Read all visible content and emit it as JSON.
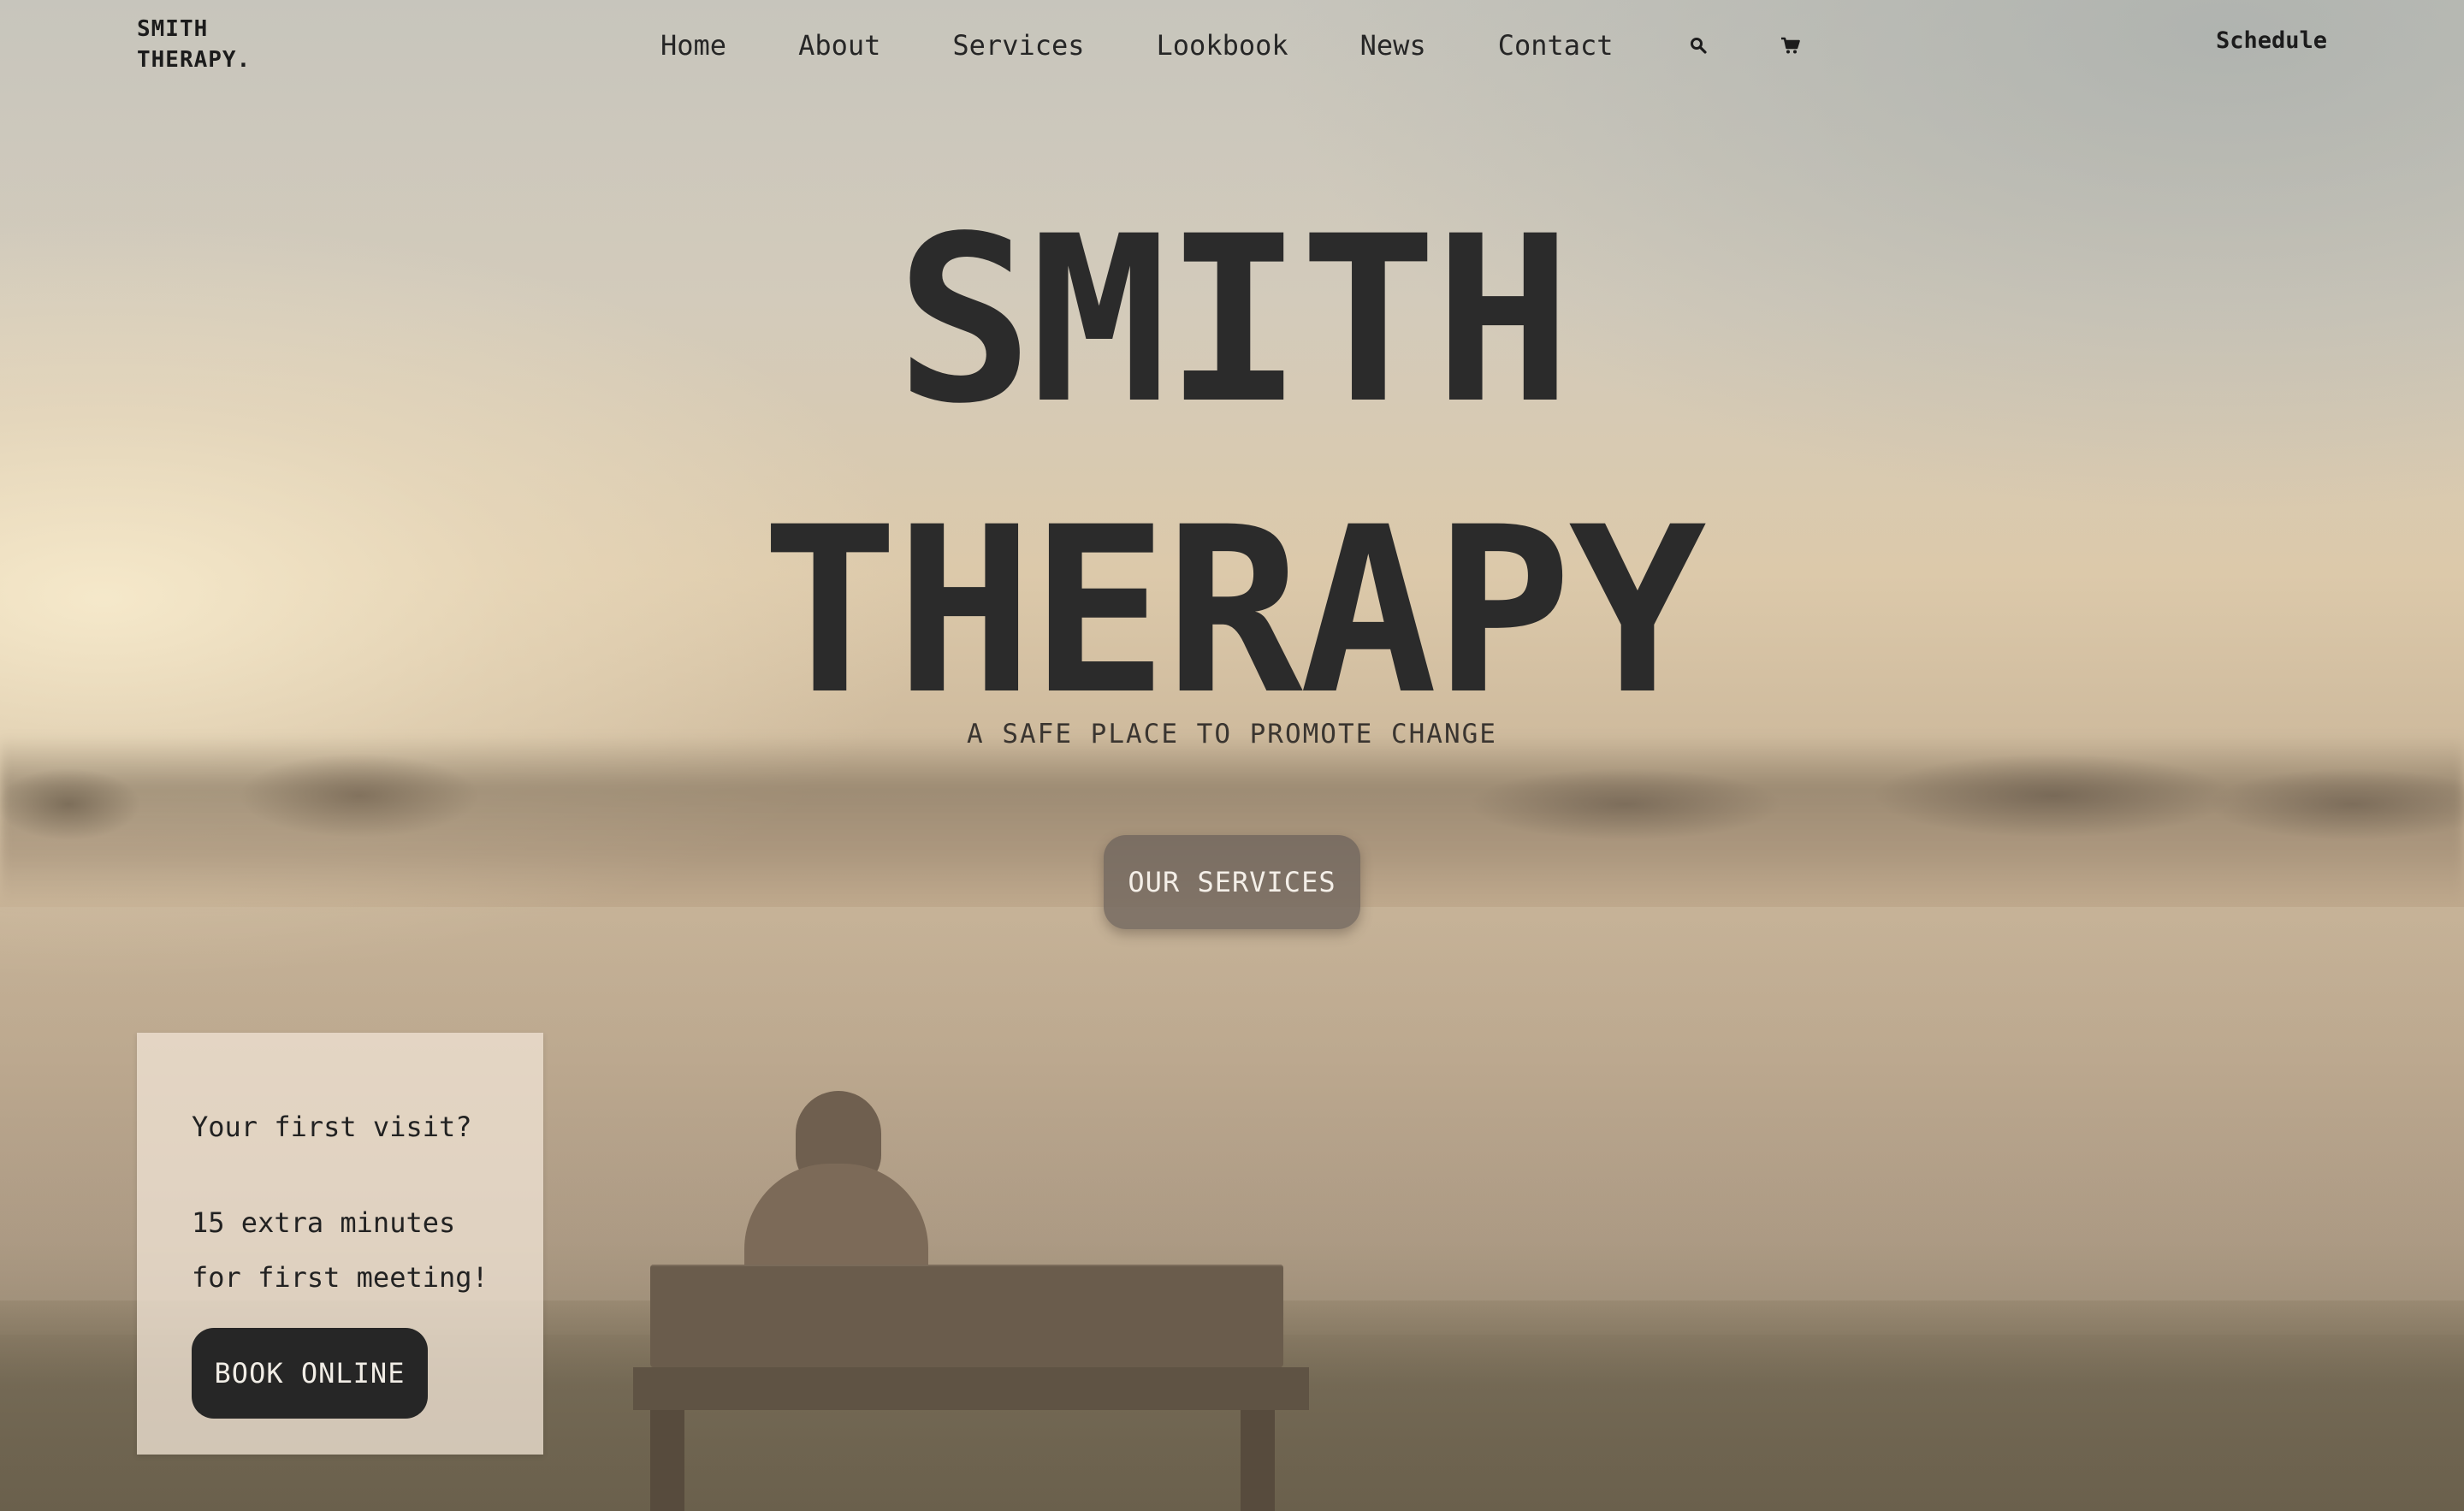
{
  "brand": {
    "line1": "SMITH",
    "line2": "THERAPY."
  },
  "nav": {
    "items": [
      {
        "label": "Home"
      },
      {
        "label": "About"
      },
      {
        "label": "Services"
      },
      {
        "label": "Lookbook"
      },
      {
        "label": "News"
      },
      {
        "label": "Contact"
      }
    ],
    "search_icon": "search-icon",
    "cart_icon": "cart-icon"
  },
  "header": {
    "schedule_label": "Schedule"
  },
  "hero": {
    "title_line1": "SMITH",
    "title_line2": "THERAPY",
    "tagline": "A SAFE PLACE TO PROMOTE CHANGE",
    "cta_label": "OUR SERVICES"
  },
  "visit_card": {
    "question": "Your first visit?",
    "desc_line1": "15 extra minutes",
    "desc_line2": "for first meeting!",
    "button_label": "BOOK ONLINE"
  },
  "colors": {
    "text_dark": "#262626",
    "button_dark": "#262626",
    "services_button": "#6e645c",
    "card_background": "#eee2d2"
  }
}
